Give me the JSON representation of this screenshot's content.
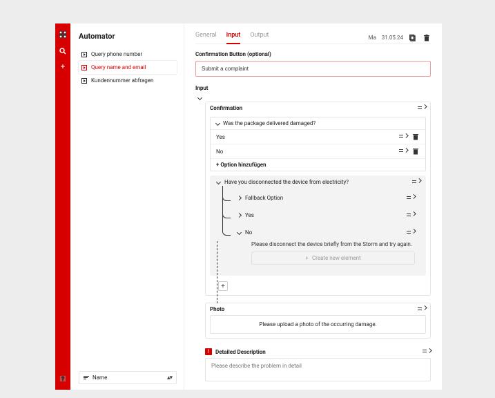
{
  "sidebar": {
    "title": "Automator",
    "items": [
      {
        "label": "Query phone number",
        "active": false
      },
      {
        "label": "Query name and email",
        "active": true
      },
      {
        "label": "Kundennummer abfragen",
        "active": false
      }
    ],
    "sort_label": "Name"
  },
  "header": {
    "tabs": [
      "General",
      "Input",
      "Output"
    ],
    "active_tab": "Input",
    "date_prefix": "Ma",
    "date": "31.05.24"
  },
  "confirmation_section": {
    "label": "Confirmation Button (optional)",
    "value": "Submit a complaint"
  },
  "input_section": {
    "label": "Input",
    "confirmation": {
      "title": "Confirmation",
      "question": "Was the package delivered damaged?",
      "options": [
        "Yes",
        "No"
      ],
      "add_option": "+ Option hinzufügen"
    },
    "branch": {
      "question": "Have you disconnected the device from electricity?",
      "fallback_label": "Fallback Option",
      "yes_label": "Yes",
      "no_label": "No",
      "no_message": "Please disconnect the device briefly from the Storm and try again.",
      "new_element": "Create new element"
    },
    "photo": {
      "title": "Photo",
      "body": "Please upload a photo of the occurring damage."
    },
    "detailed": {
      "title": "Detailed Description",
      "placeholder": "Please describe the problem in detail"
    }
  }
}
